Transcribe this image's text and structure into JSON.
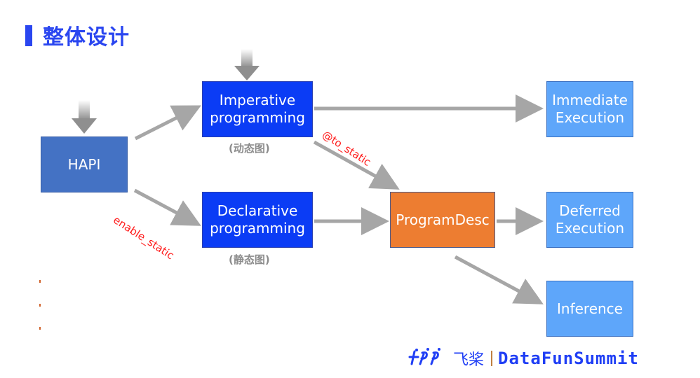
{
  "slide": {
    "title": "整体设计"
  },
  "nodes": {
    "hapi": "HAPI",
    "imperative": "Imperative\nprogramming",
    "declarative": "Declarative\nprogramming",
    "program_desc": "ProgramDesc",
    "immediate_execution": "Immediate\nExecution",
    "deferred_execution": "Deferred\nExecution",
    "inference": "Inference"
  },
  "captions": {
    "imperative": "(动态图)",
    "declarative": "(静态图)"
  },
  "edge_labels": {
    "enable_static": "enable_static",
    "to_static": "@to_static"
  },
  "footer": {
    "logo_mark": "꩜PP",
    "logo_cn": "飞桨",
    "brand": "DataFunSummit"
  },
  "colors": {
    "title": "#2a46f0",
    "hapi": "#4472c4",
    "programming": "#0b3cf5",
    "program_desc": "#ed7d31",
    "execution": "#5ea6fa",
    "arrow": "#a6a6a6",
    "edge_label": "#ff1a1a"
  }
}
